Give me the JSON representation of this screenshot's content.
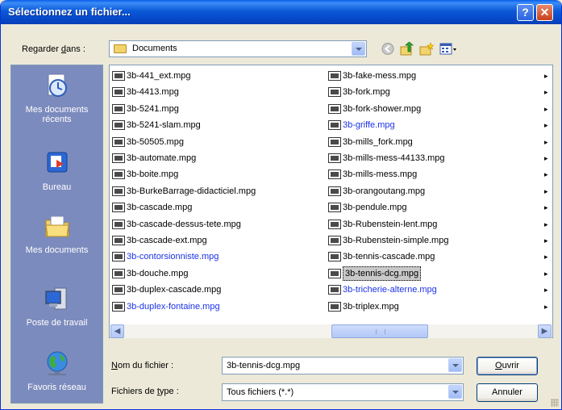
{
  "window": {
    "title": "Sélectionnez un fichier...",
    "help_icon": "?",
    "close_icon": "✕"
  },
  "look_in": {
    "label_prefix": "Regarder ",
    "label_underlined": "d",
    "label_suffix": "ans :",
    "value": "Documents"
  },
  "places": [
    {
      "label": "Mes documents récents",
      "icon": "recent-documents-icon"
    },
    {
      "label": "Bureau",
      "icon": "desktop-icon"
    },
    {
      "label": "Mes documents",
      "icon": "my-documents-icon"
    },
    {
      "label": "Poste de travail",
      "icon": "my-computer-icon"
    },
    {
      "label": "Favoris réseau",
      "icon": "network-icon"
    }
  ],
  "files_col1": [
    {
      "name": "3b-441_ext.mpg",
      "blue": false
    },
    {
      "name": "3b-4413.mpg",
      "blue": false
    },
    {
      "name": "3b-5241.mpg",
      "blue": false
    },
    {
      "name": "3b-5241-slam.mpg",
      "blue": false
    },
    {
      "name": "3b-50505.mpg",
      "blue": false
    },
    {
      "name": "3b-automate.mpg",
      "blue": false
    },
    {
      "name": "3b-boite.mpg",
      "blue": false
    },
    {
      "name": "3b-BurkeBarrage-didacticiel.mpg",
      "blue": false
    },
    {
      "name": "3b-cascade.mpg",
      "blue": false
    },
    {
      "name": "3b-cascade-dessus-tete.mpg",
      "blue": false
    },
    {
      "name": "3b-cascade-ext.mpg",
      "blue": false
    },
    {
      "name": "3b-contorsionniste.mpg",
      "blue": true
    },
    {
      "name": "3b-douche.mpg",
      "blue": false
    },
    {
      "name": "3b-duplex-cascade.mpg",
      "blue": false
    },
    {
      "name": "3b-duplex-fontaine.mpg",
      "blue": true
    }
  ],
  "files_col2": [
    {
      "name": "3b-fake-mess.mpg",
      "blue": false
    },
    {
      "name": "3b-fork.mpg",
      "blue": false
    },
    {
      "name": "3b-fork-shower.mpg",
      "blue": false
    },
    {
      "name": "3b-griffe.mpg",
      "blue": true
    },
    {
      "name": "3b-mills_fork.mpg",
      "blue": false
    },
    {
      "name": "3b-mills-mess-44133.mpg",
      "blue": false
    },
    {
      "name": "3b-mills-mess.mpg",
      "blue": false
    },
    {
      "name": "3b-orangoutang.mpg",
      "blue": false
    },
    {
      "name": "3b-pendule.mpg",
      "blue": false
    },
    {
      "name": "3b-Rubenstein-lent.mpg",
      "blue": false
    },
    {
      "name": "3b-Rubenstein-simple.mpg",
      "blue": false
    },
    {
      "name": "3b-tennis-cascade.mpg",
      "blue": false
    },
    {
      "name": "3b-tennis-dcg.mpg",
      "blue": false,
      "selected": true
    },
    {
      "name": "3b-tricherie-alterne.mpg",
      "blue": true
    },
    {
      "name": "3b-triplex.mpg",
      "blue": false
    }
  ],
  "filename": {
    "label_underlined": "N",
    "label_rest": "om du fichier :",
    "value": "3b-tennis-dcg.mpg"
  },
  "filetype": {
    "label_prefix": "Fichiers de ",
    "label_underlined": "t",
    "label_suffix": "ype :",
    "value": "Tous fichiers (*.*)"
  },
  "buttons": {
    "open_underlined": "O",
    "open_rest": "uvrir",
    "cancel": "Annuler"
  },
  "colors": {
    "titlebar": "#0a5ee8",
    "places_bg": "#7c8bbd",
    "link_blue": "#1b32e8"
  }
}
